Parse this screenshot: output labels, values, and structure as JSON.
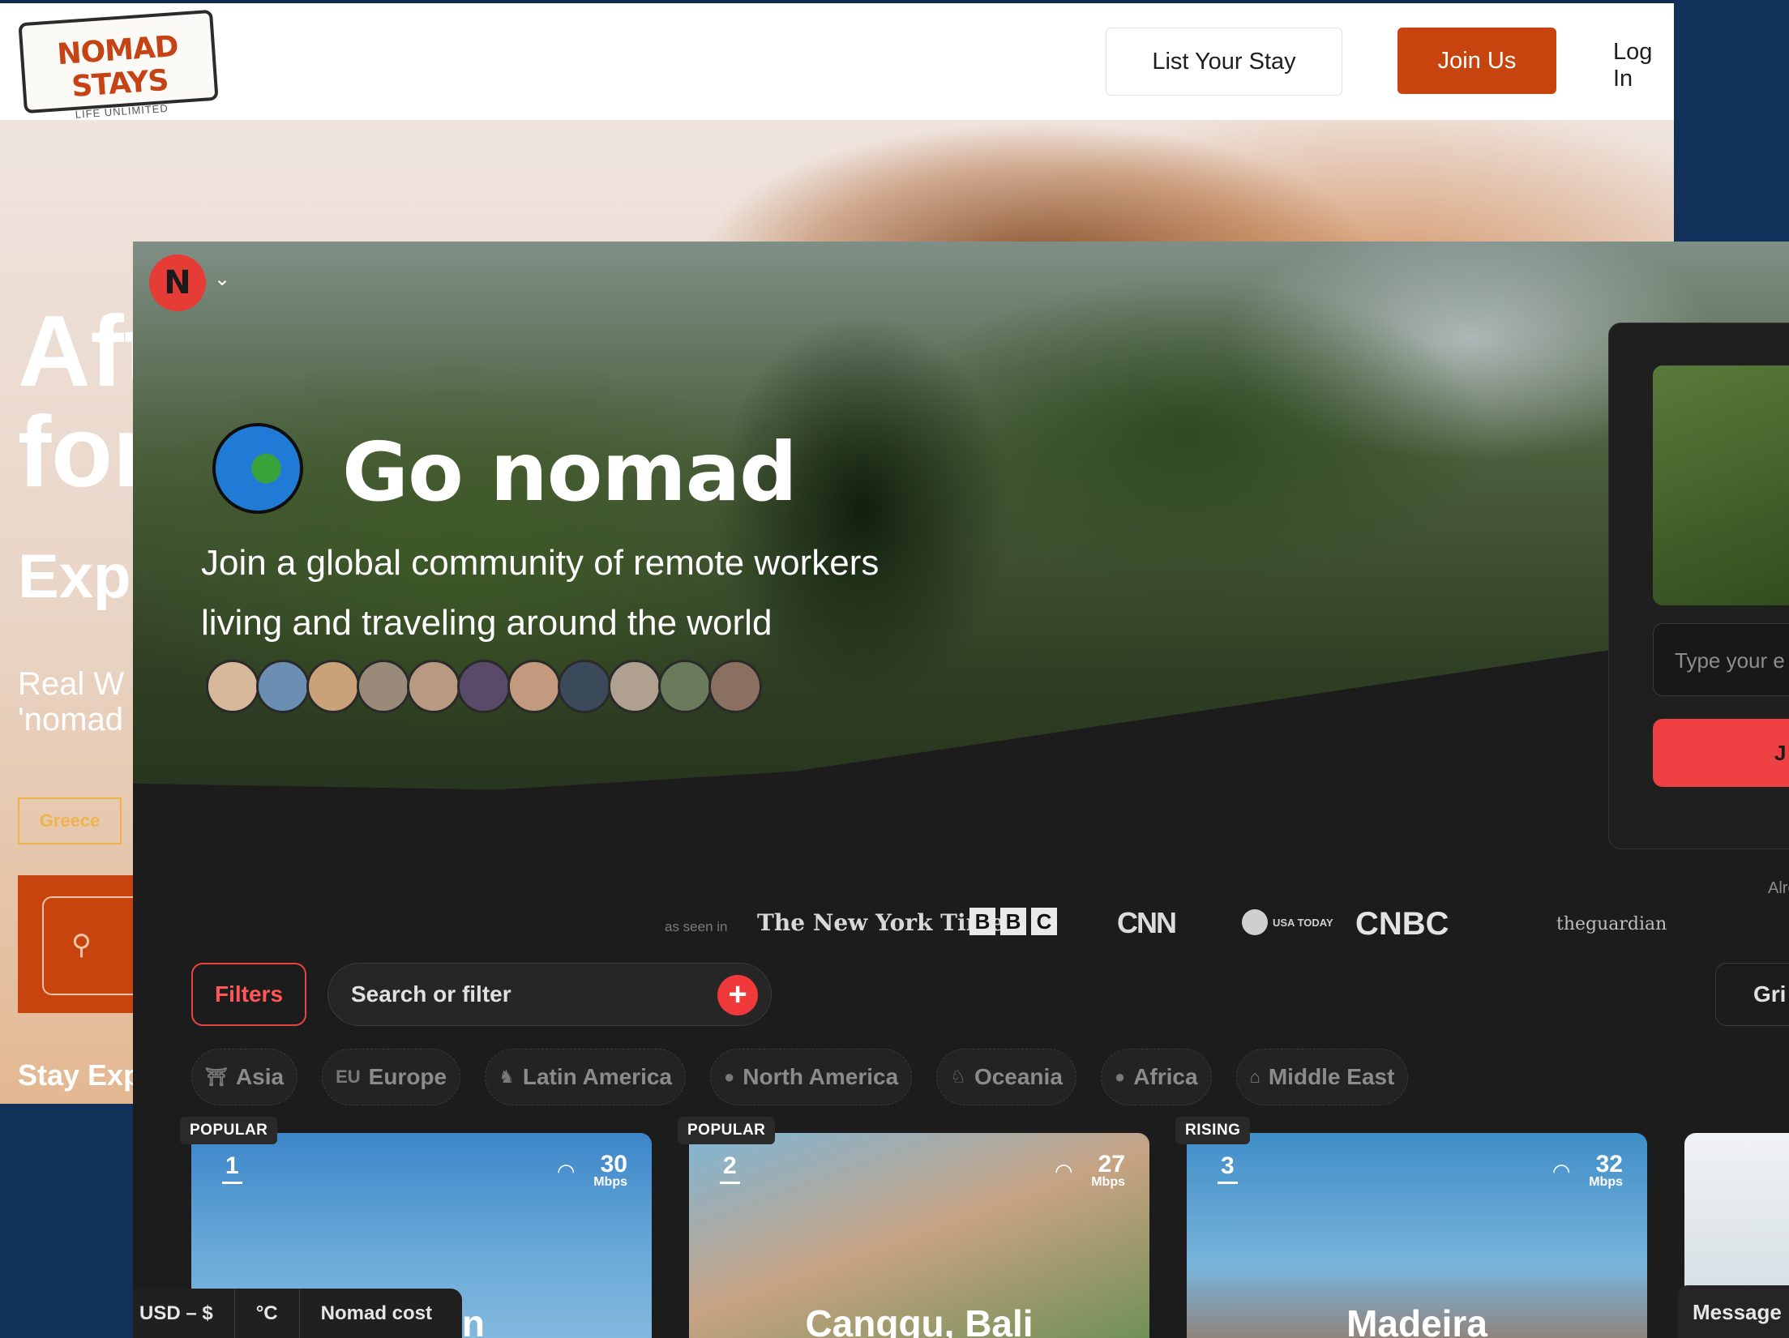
{
  "back": {
    "logo_title": "NOMAD STAYS",
    "logo_tagline": "LIFE UNLIMITED",
    "nav": {
      "list_stay": "List Your Stay",
      "join": "Join Us",
      "login": "Log In"
    },
    "headline": "Aft\nfor",
    "subhead": "Expl",
    "desc": "Real W\n'nomad",
    "chip": "Greece",
    "stay_label": "Stay Exp",
    "accent": "#c8440f"
  },
  "front": {
    "hero": {
      "title": "Go nomad",
      "subtitle_line1": "Join a global community of remote workers",
      "subtitle_line2": "living and traveling around the world",
      "avatar_count": 11
    },
    "signup": {
      "email_placeholder": "Type your e",
      "join_label": "J",
      "already": "Alre"
    },
    "as_seen_in": {
      "label": "as seen in",
      "outlets": [
        "The New York Times",
        "BBC",
        "CNN",
        "USA TODAY",
        "CNBC",
        "theguardian"
      ]
    },
    "toolbar": {
      "filters": "Filters",
      "search_placeholder": "Search or filter",
      "view": "Gri"
    },
    "regions": [
      {
        "icon": "torii-icon",
        "label": "Asia"
      },
      {
        "icon": "eu-icon",
        "label": "Europe"
      },
      {
        "icon": "dancer-icon",
        "label": "Latin America"
      },
      {
        "icon": "globe-americas-icon",
        "label": "North America"
      },
      {
        "icon": "kangaroo-icon",
        "label": "Oceania"
      },
      {
        "icon": "globe-africa-icon",
        "label": "Africa"
      },
      {
        "icon": "mosque-icon",
        "label": "Middle East"
      }
    ],
    "cards": [
      {
        "badge": "POPULAR",
        "rank": "1",
        "speed": "30",
        "unit": "Mbps",
        "city": "n"
      },
      {
        "badge": "POPULAR",
        "rank": "2",
        "speed": "27",
        "unit": "Mbps",
        "city": "Canggu, Bali"
      },
      {
        "badge": "RISING",
        "rank": "3",
        "speed": "32",
        "unit": "Mbps",
        "city": "Madeira"
      }
    ],
    "bottom_bar": {
      "currency": "USD – $",
      "temp": "°C",
      "cost": "Nomad cost"
    },
    "message": "Message",
    "accent": "#ef4143"
  }
}
